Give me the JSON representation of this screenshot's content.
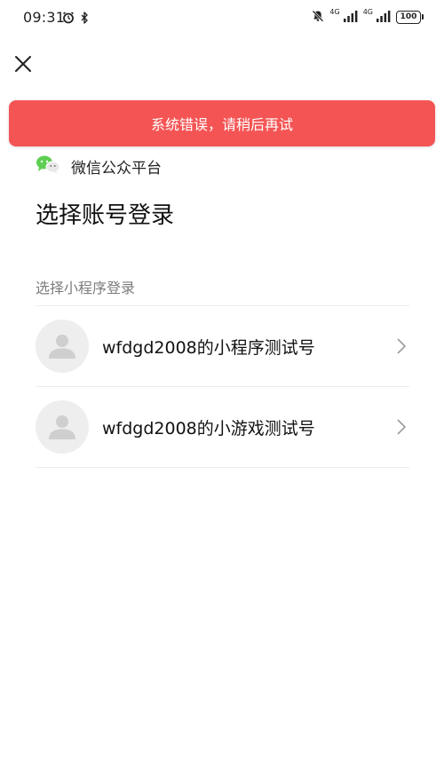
{
  "status_bar": {
    "time": "09:31",
    "network_1": "4G",
    "network_2": "4G",
    "battery": "100"
  },
  "toast": {
    "message": "系统错误，请稍后再试",
    "background": "#f55454"
  },
  "platform": {
    "name": "微信公众平台",
    "icon": "wechat-icon"
  },
  "title": "选择账号登录",
  "section_label": "选择小程序登录",
  "accounts": [
    {
      "name": "wfdgd2008的小程序测试号"
    },
    {
      "name": "wfdgd2008的小游戏测试号"
    }
  ]
}
